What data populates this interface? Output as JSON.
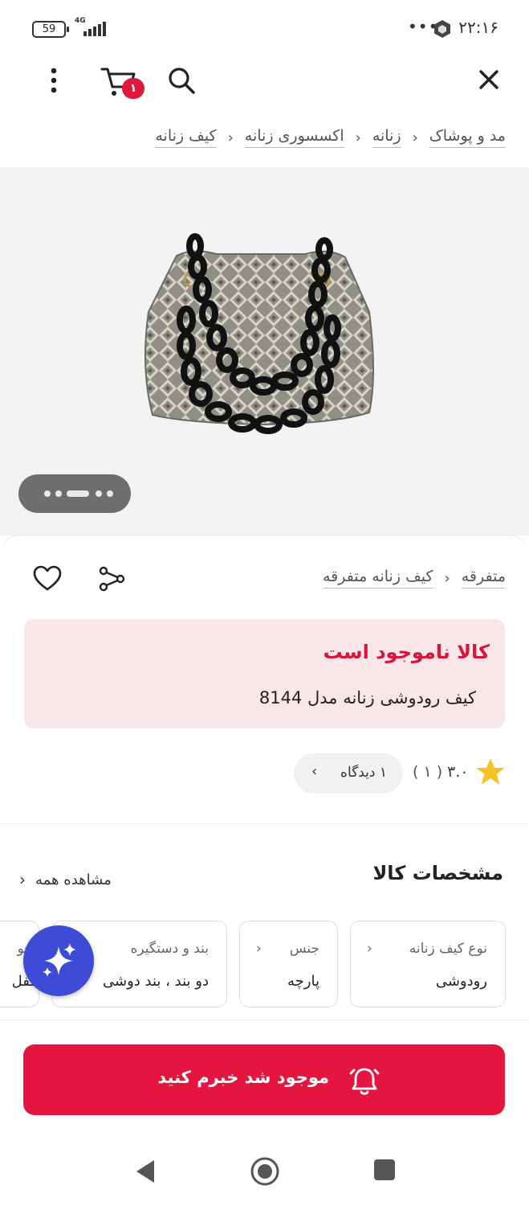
{
  "status_bar": {
    "battery": "59",
    "network": "4G",
    "time": "۲۲:۱۶",
    "overflow": "•••"
  },
  "app_bar": {
    "cart_count": "۱",
    "icons": [
      "close-icon",
      "search-icon",
      "cart-icon",
      "more-vertical-icon"
    ]
  },
  "breadcrumb": {
    "items": [
      "مد و پوشاک",
      "زنانه",
      "اکسسوری زنانه",
      "کیف زنانه"
    ],
    "separator": "‹"
  },
  "gallery": {
    "dots": 5,
    "active_dot": 3
  },
  "product": {
    "category_crumbs": [
      "متفرقه",
      "کیف زنانه متفرقه"
    ],
    "stock_status": "کالا ناموجود است",
    "title": "کیف رودوشی زنانه مدل 8144",
    "rating": "۳.۰",
    "rating_count": "( ۱ )",
    "reviews_label": "۱ دیدگاه"
  },
  "specs": {
    "title": "مشخصات کالا",
    "see_all": "مشاهده همه",
    "items": [
      {
        "label": "نوع کیف زنانه",
        "value": "رودوشی"
      },
      {
        "label": "جنس",
        "value": "پارچه"
      },
      {
        "label": "بند و دستگیره",
        "value": "دو بند ، بند دوشی"
      },
      {
        "label": "نحو",
        "value": "قفل"
      }
    ]
  },
  "cta": {
    "notify_label": "موجود شد خبرم کنید"
  },
  "colors": {
    "accent": "#e4163f",
    "oos_bg": "#f8e6e8",
    "ai_fab": "#3d4bd6"
  }
}
